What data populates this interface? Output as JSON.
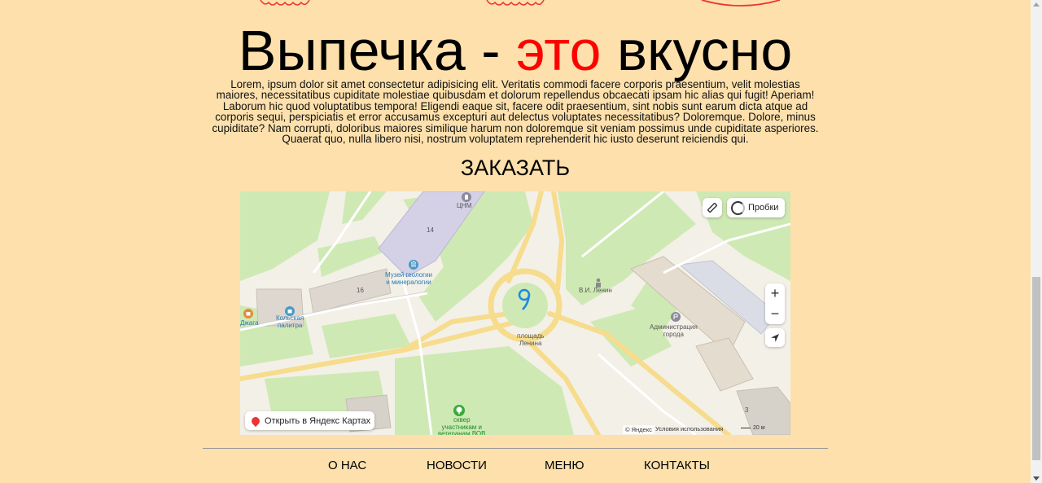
{
  "hero": {
    "title_part1": "Выпечка - ",
    "title_accent": "это",
    "title_part2": " вкусно",
    "accent_color": "#ff0000",
    "description": "Lorem, ipsum dolor sit amet consectetur adipisicing elit. Veritatis commodi facere corporis praesentium, velit molestias maiores, necessitatibus cupiditate molestiae quibusdam et dolorum repellendus obcaecati ipsam hic alias qui fugit! Aperiam! Laborum hic quod voluptatibus tempora! Eligendi eaque sit, facere odit praesentium, sint nobis sunt earum dicta atque ad corporis sequi, perspiciatis et error accusamus excepturi aut delectus voluptates necessitatibus? Doloremque. Dolore, minus cupiditate? Nam corrupti, doloribus maiores similique harum non doloremque sit veniam possimus unde cupiditate asperiores. Quaerat quo, nulla libero nisi, nostrum voluptatem reprehenderit hic iusto deserunt reiciendis qui."
  },
  "order": {
    "label": "ЗАКАЗАТЬ"
  },
  "map": {
    "traffic_label": "Пробки",
    "zoom_in": "+",
    "zoom_out": "−",
    "open_label": "Открыть в Яндекс Картах",
    "copyright": "© Яндекс",
    "terms": "Условия использования",
    "scale": "20 м",
    "labels": {
      "tsnm": "ЦНМ",
      "building_14": "14",
      "museum": "Музей геологии\nи минералогии",
      "building_16": "16",
      "kolskaya": "Кольская\nпалитра",
      "dzhaga": "Джага",
      "lenin_monument": "В.И. Ленин",
      "square": "площадь\nЛенина",
      "administration": "Администрация\nгорода",
      "park": "сквер\nучастникам и\nветеранам ВОВ",
      "building_3": "3"
    },
    "icons": {
      "ruler": "ruler-icon",
      "traffic": "traffic-icon",
      "locate": "locate-arrow-icon",
      "pin": "map-pin-icon",
      "square_marker": "map-marker-9-icon"
    }
  },
  "footer": {
    "nav": [
      "О НАС",
      "НОВОСТИ",
      "МЕНЮ",
      "КОНТАКТЫ"
    ]
  }
}
